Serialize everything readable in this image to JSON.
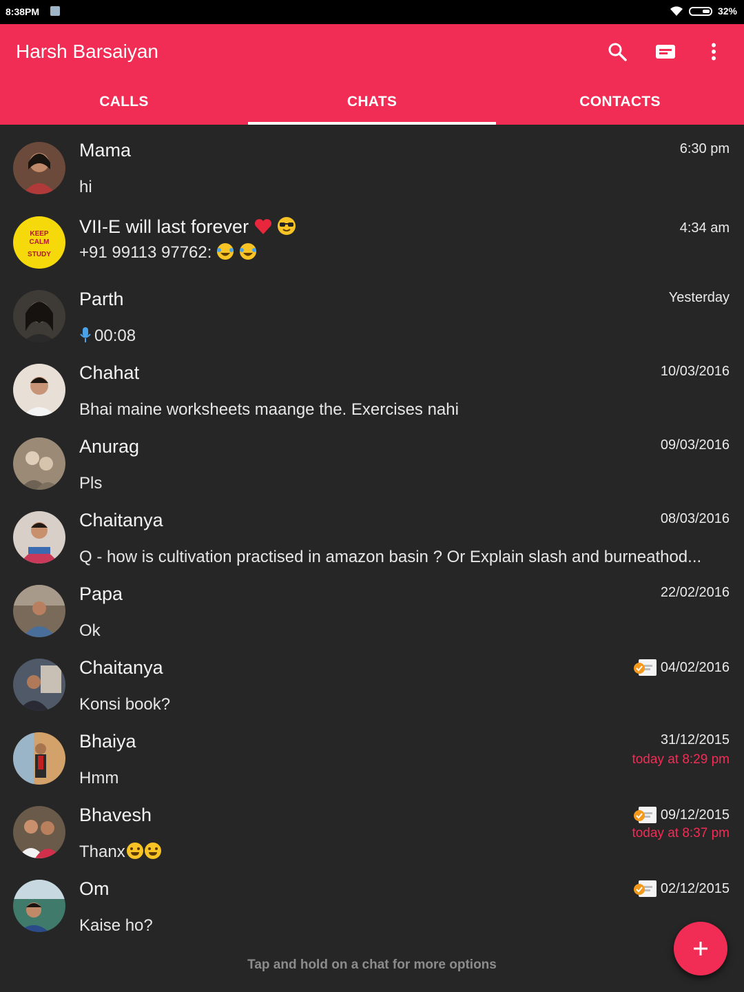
{
  "status_bar": {
    "time": "8:38PM",
    "battery": "32%"
  },
  "app_bar": {
    "title": "Harsh Barsaiyan"
  },
  "tabs": [
    {
      "label": "CALLS",
      "active": false
    },
    {
      "label": "CHATS",
      "active": true
    },
    {
      "label": "CONTACTS",
      "active": false
    }
  ],
  "colors": {
    "accent": "#f12d56",
    "background": "#262626",
    "status_bar": "#000000"
  },
  "chats": [
    {
      "name": "Mama",
      "message": "hi",
      "time": "6:30 pm",
      "sub": "",
      "scheduled": false,
      "avatar_color": "#6b4a3b"
    },
    {
      "name": "VII-E will last forever",
      "message": "+91 99113 97762: ",
      "time": "4:34 am",
      "sub": "",
      "scheduled": false,
      "avatar_color": "#f5d90a"
    },
    {
      "name": "Parth",
      "message": "00:08",
      "time": "Yesterday",
      "sub": "",
      "scheduled": false,
      "avatar_color": "#3e3a36",
      "voice": true
    },
    {
      "name": "Chahat",
      "message": "Bhai maine worksheets maange the. Exercises nahi",
      "time": "10/03/2016",
      "sub": "",
      "scheduled": false,
      "avatar_color": "#c8b8a8"
    },
    {
      "name": "Anurag",
      "message": "Pls",
      "time": "09/03/2016",
      "sub": "",
      "scheduled": false,
      "avatar_color": "#8a7a68"
    },
    {
      "name": "Chaitanya",
      "message": "Q - how is cultivation practised in amazon basin ?  Or Explain slash and burneathod...",
      "time": "08/03/2016",
      "sub": "",
      "scheduled": false,
      "avatar_color": "#c75a6a"
    },
    {
      "name": "Papa",
      "message": "Ok",
      "time": "22/02/2016",
      "sub": "",
      "scheduled": false,
      "avatar_color": "#5a6f88"
    },
    {
      "name": "Chaitanya",
      "message": "Konsi book?",
      "time": "04/02/2016",
      "sub": "",
      "scheduled": true,
      "avatar_color": "#4f5968"
    },
    {
      "name": "Bhaiya",
      "message": "Hmm",
      "time": "31/12/2015",
      "sub": "today at 8:29 pm",
      "scheduled": false,
      "avatar_color": "#b58a5a"
    },
    {
      "name": "Bhavesh",
      "message": "Thanx",
      "time": "09/12/2015",
      "sub": "today at 8:37 pm",
      "scheduled": true,
      "avatar_color": "#8a5a4a"
    },
    {
      "name": "Om",
      "message": "Kaise ho?",
      "time": "02/12/2015",
      "sub": "",
      "scheduled": true,
      "avatar_color": "#3f7a6a"
    }
  ],
  "footer_hint": "Tap and hold on a chat for more options",
  "icons": {
    "search": "search-icon",
    "new_message": "message-icon",
    "more": "more-vert-icon",
    "fab": "plus-icon"
  }
}
